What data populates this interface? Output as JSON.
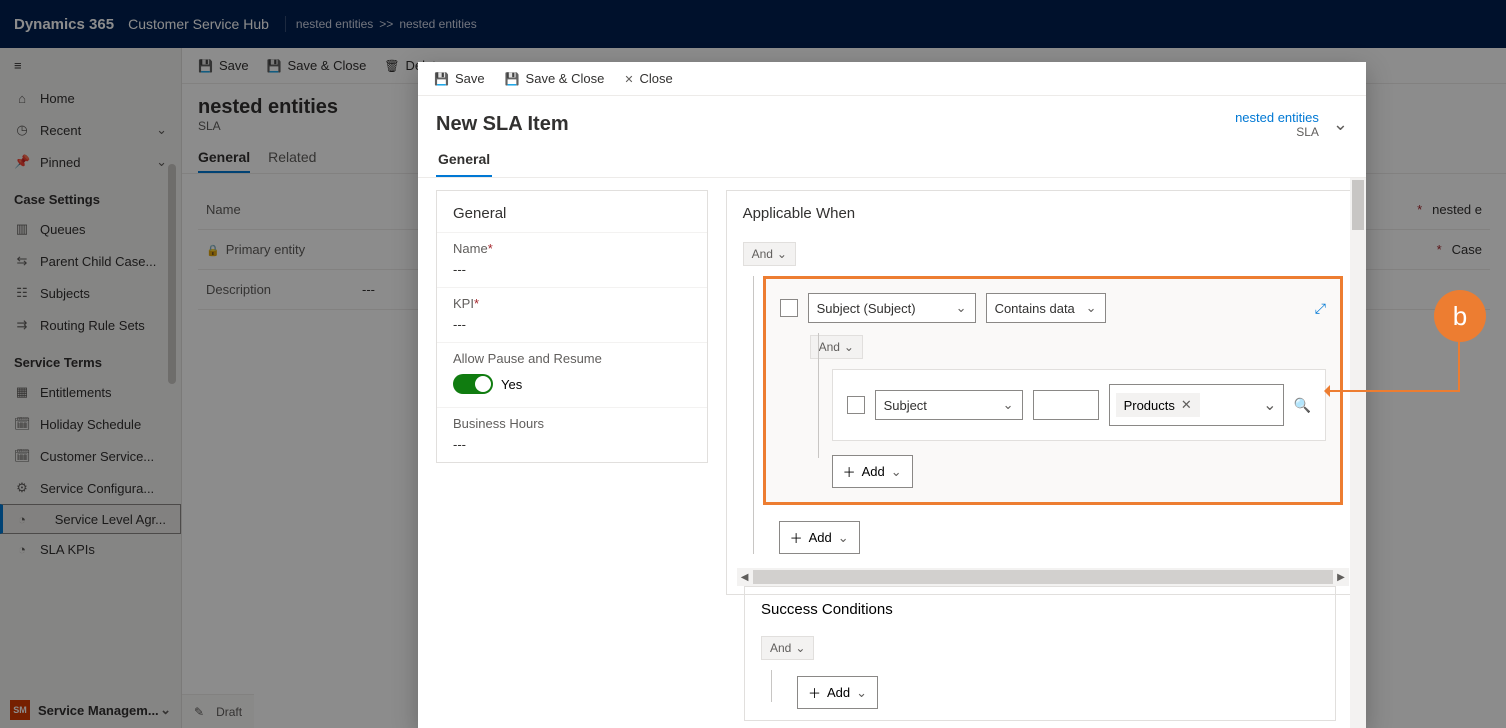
{
  "bg": {
    "brand": "Dynamics 365",
    "hub": "Customer Service Hub",
    "bc1": "nested entities",
    "bcsep": ">>",
    "bc2": "nested entities",
    "cmd": {
      "save": "Save",
      "saveclose": "Save & Close",
      "delete": "Delete"
    },
    "nav": {
      "home": "Home",
      "recent": "Recent",
      "pinned": "Pinned",
      "sect1": "Case Settings",
      "queues": "Queues",
      "pcc": "Parent Child Case...",
      "subjects": "Subjects",
      "rrs": "Routing Rule Sets",
      "sect2": "Service Terms",
      "ent": "Entitlements",
      "hol": "Holiday Schedule",
      "cs": "Customer Service...",
      "sc": "Service Configura...",
      "sla": "Service Level Agr...",
      "kpi": "SLA KPIs",
      "sm": "Service Managem...",
      "smb": "SM"
    },
    "title": "nested entities",
    "titlesub": "SLA",
    "tabs": {
      "general": "General",
      "related": "Related"
    },
    "form": {
      "name_l": "Name",
      "name_v": "nested e",
      "pe_l": "Primary entity",
      "pe_v": "Case",
      "desc_l": "Description",
      "desc_v": "---"
    },
    "foot": "Draft"
  },
  "panel": {
    "cmd": {
      "save": "Save",
      "saveclose": "Save & Close",
      "close": "Close"
    },
    "title": "New SLA Item",
    "rec": {
      "link": "nested entities",
      "sub": "SLA"
    },
    "tab": "General",
    "gen": {
      "title": "General",
      "name_l": "Name",
      "name_v": "---",
      "kpi_l": "KPI",
      "kpi_v": "---",
      "apr_l": "Allow Pause and Resume",
      "apr_v": "Yes",
      "bh_l": "Business Hours",
      "bh_v": "---"
    },
    "app": {
      "title": "Applicable When",
      "and": "And",
      "field1": "Subject (Subject)",
      "op1": "Contains data",
      "field2": "Subject",
      "tag": "Products",
      "add": "Add"
    },
    "succ": {
      "title": "Success Conditions",
      "and": "And",
      "add": "Add"
    }
  },
  "ann": {
    "b": "b"
  }
}
